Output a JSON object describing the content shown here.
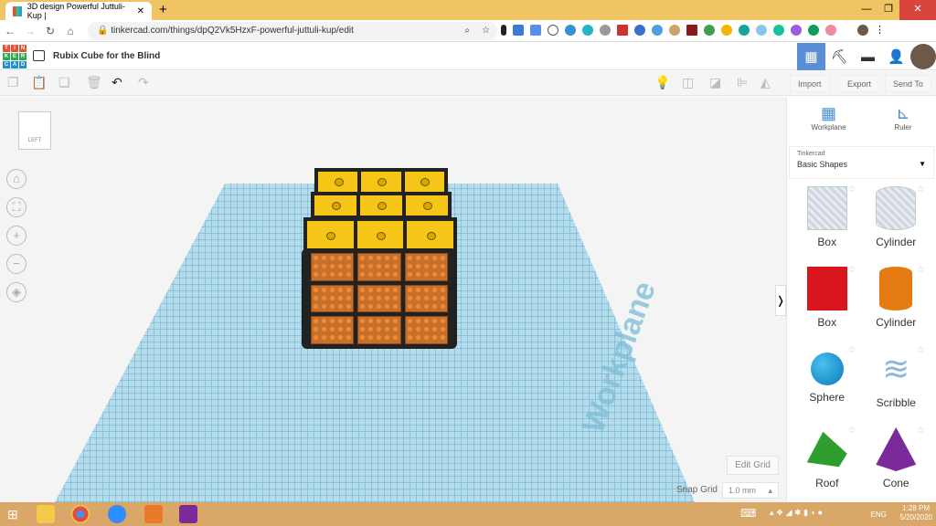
{
  "browser": {
    "tab_title": "3D design Powerful Juttuli-Kup |",
    "url": "tinkercad.com/things/dpQ2Vk5HzxF-powerful-juttuli-kup/edit"
  },
  "app": {
    "logo": "TINKERCAD",
    "title": "Rubix Cube for the Blind"
  },
  "toolbar": {
    "import": "Import",
    "export": "Export",
    "send_to": "Send To"
  },
  "viewcube": {
    "face": "LEFT"
  },
  "workplane": {
    "label": "Workplane",
    "edit_grid": "Edit Grid",
    "snap_grid_label": "Snap Grid",
    "snap_grid_value": "1.0 mm"
  },
  "panel": {
    "workplane": "Workplane",
    "ruler": "Ruler",
    "library_source": "Tinkercad",
    "library": "Basic Shapes",
    "shapes": [
      {
        "label": "Box"
      },
      {
        "label": "Cylinder"
      },
      {
        "label": "Box"
      },
      {
        "label": "Cylinder"
      },
      {
        "label": "Sphere"
      },
      {
        "label": "Scribble"
      },
      {
        "label": "Roof"
      },
      {
        "label": "Cone"
      }
    ]
  },
  "taskbar": {
    "lang": "ENG",
    "time": "1:28 PM",
    "date": "5/20/2020"
  }
}
